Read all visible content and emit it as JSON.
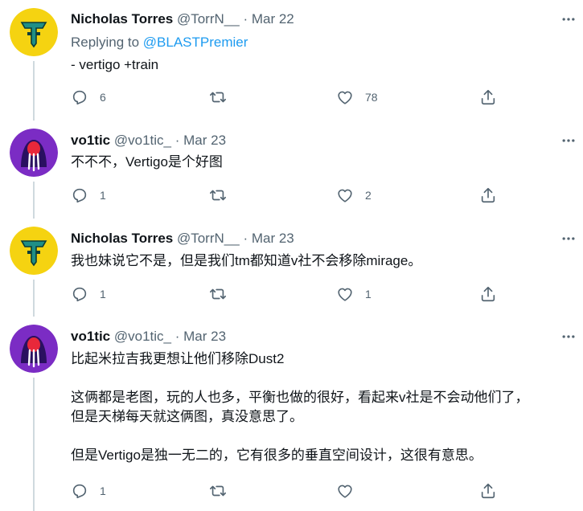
{
  "tweets": [
    {
      "name": "Nicholas Torres",
      "handle": "@TorrN__",
      "dot": "·",
      "date": "Mar 22",
      "reply_prefix": "Replying to ",
      "reply_to": "@BLASTPremier",
      "text": "- vertigo +train",
      "replies": "6",
      "retweets": "",
      "likes": "78",
      "avatar_icon": "torres-logo-icon"
    },
    {
      "name": "vo1tic",
      "handle": "@vo1tic_",
      "dot": "·",
      "date": "Mar 23",
      "text": "不不不，Vertigo是个好图",
      "replies": "1",
      "retweets": "",
      "likes": "2",
      "avatar_icon": "walrus-avatar-icon"
    },
    {
      "name": "Nicholas Torres",
      "handle": "@TorrN__",
      "dot": "·",
      "date": "Mar 23",
      "text": "我也妹说它不是，但是我们tm都知道v社不会移除mirage。",
      "replies": "1",
      "retweets": "",
      "likes": "1",
      "avatar_icon": "torres-logo-icon"
    },
    {
      "name": "vo1tic",
      "handle": "@vo1tic_",
      "dot": "·",
      "date": "Mar 23",
      "text": "比起米拉吉我更想让他们移除Dust2\n\n这俩都是老图，玩的人也多，平衡也做的很好，看起来v社是不会动他们了，\n但是天梯每天就这俩图，真没意思了。\n\n但是Vertigo是独一无二的，它有很多的垂直空间设计，这很有意思。",
      "replies": "1",
      "retweets": "",
      "likes": "",
      "avatar_icon": "walrus-avatar-icon"
    }
  ],
  "colors": {
    "text": "#0f1419",
    "secondary": "#536471",
    "link": "#1d9bf0",
    "thread_line": "#cfd9de",
    "torres_avatar_bg": "#f5d311",
    "vo1tic_avatar_bg": "#7b2cc4"
  }
}
